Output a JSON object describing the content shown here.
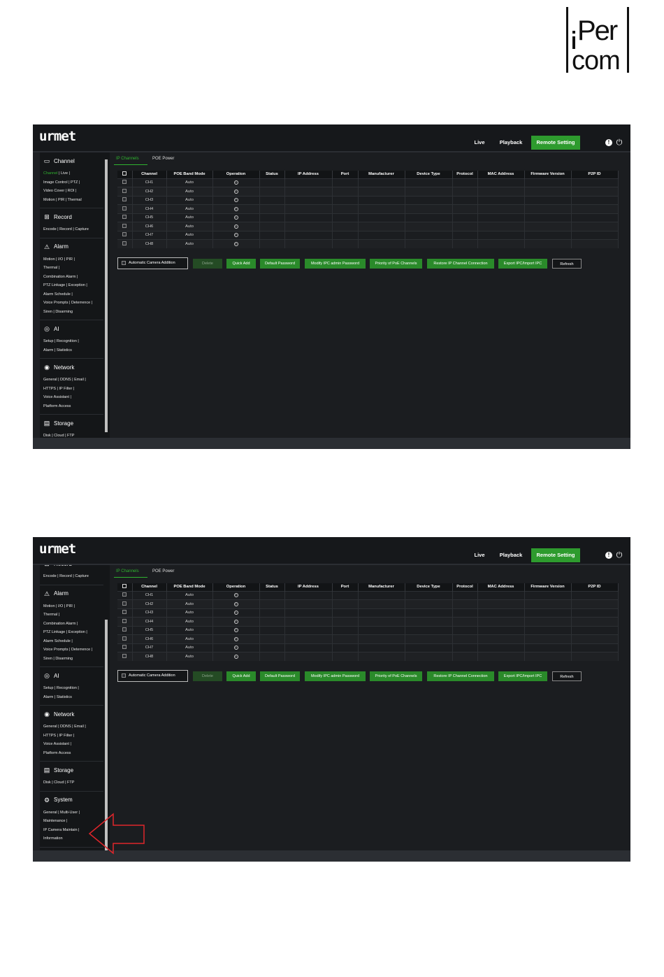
{
  "logo": {
    "line1": "Per",
    "line2": "com"
  },
  "brand": "urmet",
  "nav": {
    "live": "Live",
    "playback": "Playback",
    "remote": "Remote Setting"
  },
  "icons": {
    "info": "info-icon",
    "power": "power-icon"
  },
  "colors": {
    "accent": "#2e9b2e",
    "background": "#1e2024",
    "arrow": "#e0262b"
  },
  "tabs": {
    "ip": "IP Channels",
    "poe": "POE Power"
  },
  "table": {
    "headers": [
      "Channel",
      "POE Band Mode",
      "Operation",
      "Status",
      "IP Address",
      "Port",
      "Manufacturer",
      "Device Type",
      "Protocol",
      "MAC Address",
      "Firmware Version",
      "P2P ID"
    ],
    "rows": [
      {
        "channel": "CH1",
        "mode": "Auto"
      },
      {
        "channel": "CH2",
        "mode": "Auto"
      },
      {
        "channel": "CH3",
        "mode": "Auto"
      },
      {
        "channel": "CH4",
        "mode": "Auto"
      },
      {
        "channel": "CH5",
        "mode": "Auto"
      },
      {
        "channel": "CH6",
        "mode": "Auto"
      },
      {
        "channel": "CH7",
        "mode": "Auto"
      },
      {
        "channel": "CH8",
        "mode": "Auto"
      }
    ]
  },
  "buttons": {
    "auto": "Automatic Camera Addition",
    "delete": "Delete",
    "quick_add": "Quick Add",
    "default_password": "Default Password",
    "modify_ipc": "Modify IPC admin Password",
    "priority_poe": "Priority of PoE Channels",
    "restore_ip": "Restore IP Channel Connection",
    "export_import": "Export IPC/Import IPC",
    "refresh": "Refresh"
  },
  "sidebar": {
    "channel": {
      "title": "Channel",
      "l1a": "Channel",
      "l1b": " |  Live  |",
      "l2": "Image Control  |  PTZ  |",
      "l3": "Video Cover  |  ROI  |",
      "l4": "Motion  |  PIR  |  Thermal"
    },
    "record": {
      "title": "Record",
      "l1": "Encode  |  Record  |  Capture"
    },
    "alarm": {
      "title": "Alarm",
      "l1": "Motion  |  I/O  |  PIR  |",
      "l2": "Thermal  |",
      "l3": "Combination Alarm  |",
      "l4": "PTZ Linkage  |  Exception  |",
      "l5": "Alarm Schedule  |",
      "l6": "Voice Prompts  |  Deterrence  |",
      "l7": "Siren  |  Disarming"
    },
    "ai": {
      "title": "AI",
      "l1": "Setup  |  Recognition  |",
      "l2": "Alarm  |  Statistics"
    },
    "network": {
      "title": "Network",
      "l1": "General  |  DDNS  |  Email  |",
      "l2": "HTTPS  |  IP Filter  |",
      "l3": "Voice Assistant  |",
      "l4": "Platform Access"
    },
    "storage": {
      "title": "Storage",
      "l1": "Disk  |  Cloud  |  FTP"
    },
    "system": {
      "title": "System",
      "l1": "General  |  Multi-User  |",
      "l2": "Maintenance  |",
      "l3": "IP Camera Maintain  |",
      "l4": "Information"
    }
  }
}
